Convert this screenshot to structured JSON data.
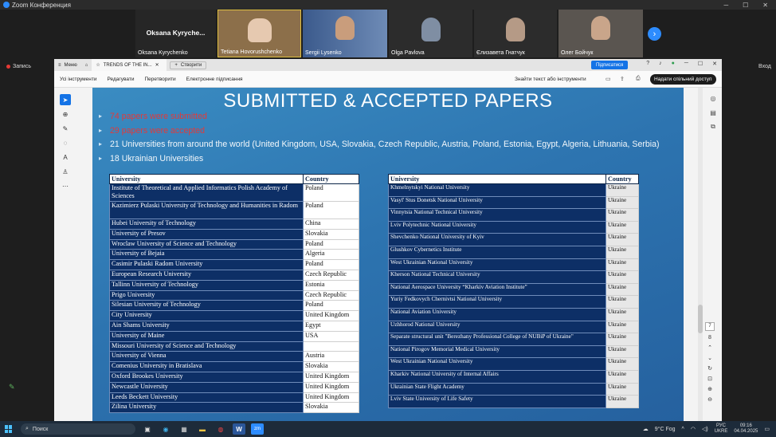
{
  "zoom": {
    "window_title": "Zoom Конференция",
    "recording_label": "Запись",
    "exit_label": "Вход",
    "participants": [
      {
        "name": "Oksana Kyrychenko",
        "big": "Oksana Kyryche...",
        "kind": "text"
      },
      {
        "name": "Tetiana Hovorushchenko",
        "kind": "video"
      },
      {
        "name": "Sergii Lysenko",
        "kind": "video"
      },
      {
        "name": "Olga Pavlova",
        "kind": "video"
      },
      {
        "name": "Єлизавета Гнатчук",
        "kind": "video"
      },
      {
        "name": "Олег Бойчук",
        "kind": "video"
      }
    ]
  },
  "acrobat": {
    "menu_label": "Меню",
    "tab_title": "TRENDS OF THE IN...",
    "new_tab_label": "Створити",
    "subscribe_label": "Підписатися",
    "menu_items": [
      "Усі інструменти",
      "Редагувати",
      "Перетворити",
      "Електронне підписання"
    ],
    "find_text": "Знайти текст або інструменти",
    "share_label": "Надати спільний доступ",
    "page_current": "7",
    "page_total": "8"
  },
  "slide": {
    "title": "SUBMITTED & ACCEPTED PAPERS",
    "bullets": [
      {
        "text": "74 papers were submitted",
        "style": "red"
      },
      {
        "text": "29 papers were accepted",
        "style": "red"
      },
      {
        "text": "21 Universities from around the world (United Kingdom, USA, Slovakia, Czech Republic, Austria, Poland, Estonia, Egypt, Algeria, Lithuania, Serbia)",
        "style": "white"
      },
      {
        "text": "18 Ukrainian Universities",
        "style": "white"
      }
    ],
    "table1": {
      "headers": [
        "University",
        "Country"
      ],
      "rows": [
        [
          "Institute of Theoretical and Applied Informatics Polish Academy of Sciences",
          "Poland"
        ],
        [
          "Kazimierz Pulaski University of Technology and Humanities in Radom",
          "Poland"
        ],
        [
          "Hubei University of Technology",
          "China"
        ],
        [
          "University of Presov",
          "Slovakia"
        ],
        [
          "Wroclaw University of Science and Technology",
          "Poland"
        ],
        [
          "University of Bejaia",
          "Algeria"
        ],
        [
          "Casimir Pulaski Radom University",
          "Poland"
        ],
        [
          "European Research University",
          "Czech Republic"
        ],
        [
          "Tallinn University of Technology",
          "Estonia"
        ],
        [
          "Prigo University",
          "Czech Republic"
        ],
        [
          "Silesian University of Technology",
          "Poland"
        ],
        [
          "City University",
          "United Kingdom"
        ],
        [
          "Ain Shams University",
          "Egypt"
        ],
        [
          "University of Maine",
          "USA"
        ],
        [
          "Missouri University of Science and Technology",
          ""
        ],
        [
          "University of Vienna",
          "Austria"
        ],
        [
          "Comenius University in Bratislava",
          "Slovakia"
        ],
        [
          "Oxford Brookes University",
          "United Kingdom"
        ],
        [
          "Newcastle University",
          "United Kingdom"
        ],
        [
          "Leeds Beckett University",
          "United Kingdom"
        ],
        [
          "Zilina University",
          "Slovakia"
        ]
      ]
    },
    "table2": {
      "headers": [
        "University",
        "Country"
      ],
      "rows": [
        [
          "Khmelnytskyi National University",
          "Ukraine"
        ],
        [
          "Vasyl' Stus Donetsk National University",
          "Ukraine"
        ],
        [
          "Vinnytsia National Technical University",
          "Ukraine"
        ],
        [
          "Lviv Polytechnic National University",
          "Ukraine"
        ],
        [
          "Shevchenko National University of Kyiv",
          "Ukraine"
        ],
        [
          "Glushkov Cybernetics Institute",
          "Ukraine"
        ],
        [
          "West Ukrainian National University",
          "Ukraine"
        ],
        [
          "Kherson National Technical University",
          "Ukraine"
        ],
        [
          "National Aerospace University “Kharkiv Aviation Institute”",
          "Ukraine"
        ],
        [
          "Yuriy Fedkovych Chernivtsi National University",
          "Ukraine"
        ],
        [
          "National Aviation University",
          "Ukraine"
        ],
        [
          "Uzhhorod National University",
          "Ukraine"
        ],
        [
          "Separate structural unit \"Berezhany Professional College of NUBiP of Ukraine\"",
          "Ukraine"
        ],
        [
          "National Pirogov Memorial Medical University",
          "Ukraine"
        ],
        [
          "West Ukrainian National University",
          "Ukraine"
        ],
        [
          "Kharkiv National University of Internal Affairs",
          "Ukraine"
        ],
        [
          "Ukrainian State Flight Academy",
          "Ukraine"
        ],
        [
          "Lviv State University of Life Safety",
          "Ukraine"
        ]
      ]
    }
  },
  "taskbar": {
    "search_label": "Поиск",
    "weather": "9°C Fog",
    "lang": "РУС",
    "lang2": "UKRE",
    "time": "09:16",
    "date": "04.04.2025"
  }
}
